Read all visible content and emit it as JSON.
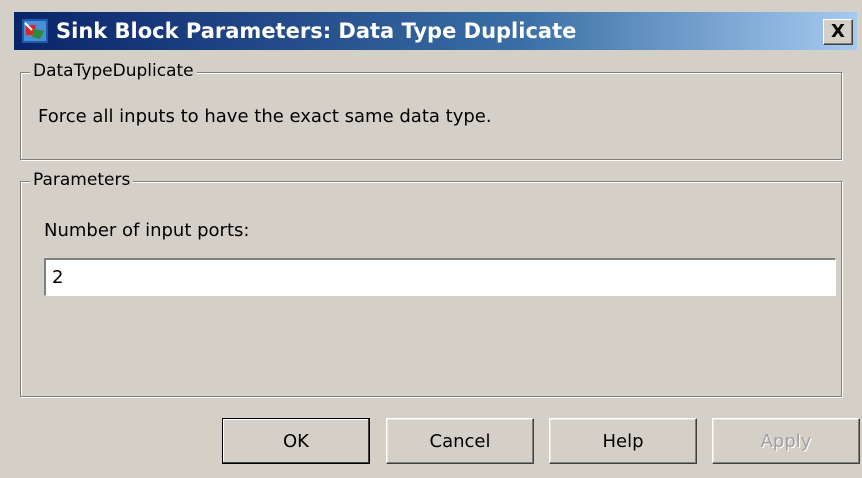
{
  "window": {
    "title": "Sink Block Parameters: Data Type Duplicate",
    "close_label": "X"
  },
  "description_group": {
    "legend": "DataTypeDuplicate",
    "text": "Force all inputs to have the exact same data type."
  },
  "parameters_group": {
    "legend": "Parameters",
    "input_ports_label": "Number of input ports:",
    "input_ports_value": "2"
  },
  "buttons": {
    "ok": "OK",
    "cancel": "Cancel",
    "help": "Help",
    "apply": "Apply"
  },
  "icons": {
    "app": "simulink-block-icon",
    "close": "close-icon"
  },
  "colors": {
    "titlebar_start": "#0a246a",
    "titlebar_end": "#a6caf0",
    "dialog_background": "#d4d0c8"
  }
}
